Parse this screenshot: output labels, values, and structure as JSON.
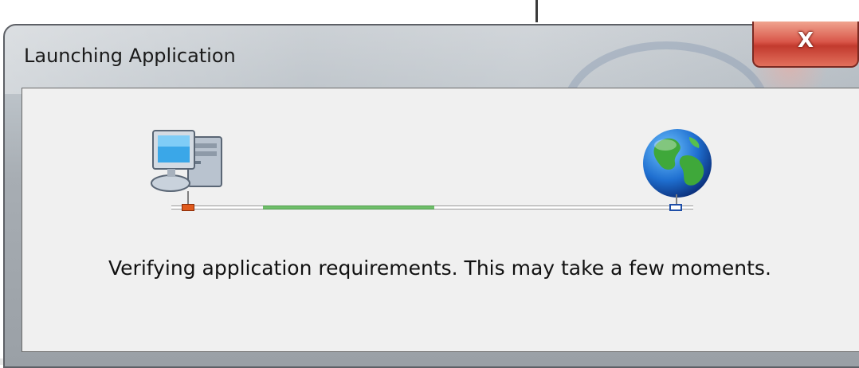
{
  "window": {
    "title": "Launching Application",
    "close_label": "X"
  },
  "status": {
    "message": "Verifying application requirements. This may take a few moments.",
    "progress_fraction": 0.33
  },
  "icons": {
    "left": "computer-icon",
    "right": "globe-icon"
  },
  "colors": {
    "progress": "#6fbf6a",
    "close_button": "#c23a2e",
    "port_left": "#e05a1c",
    "port_right": "#1e4ea8"
  }
}
